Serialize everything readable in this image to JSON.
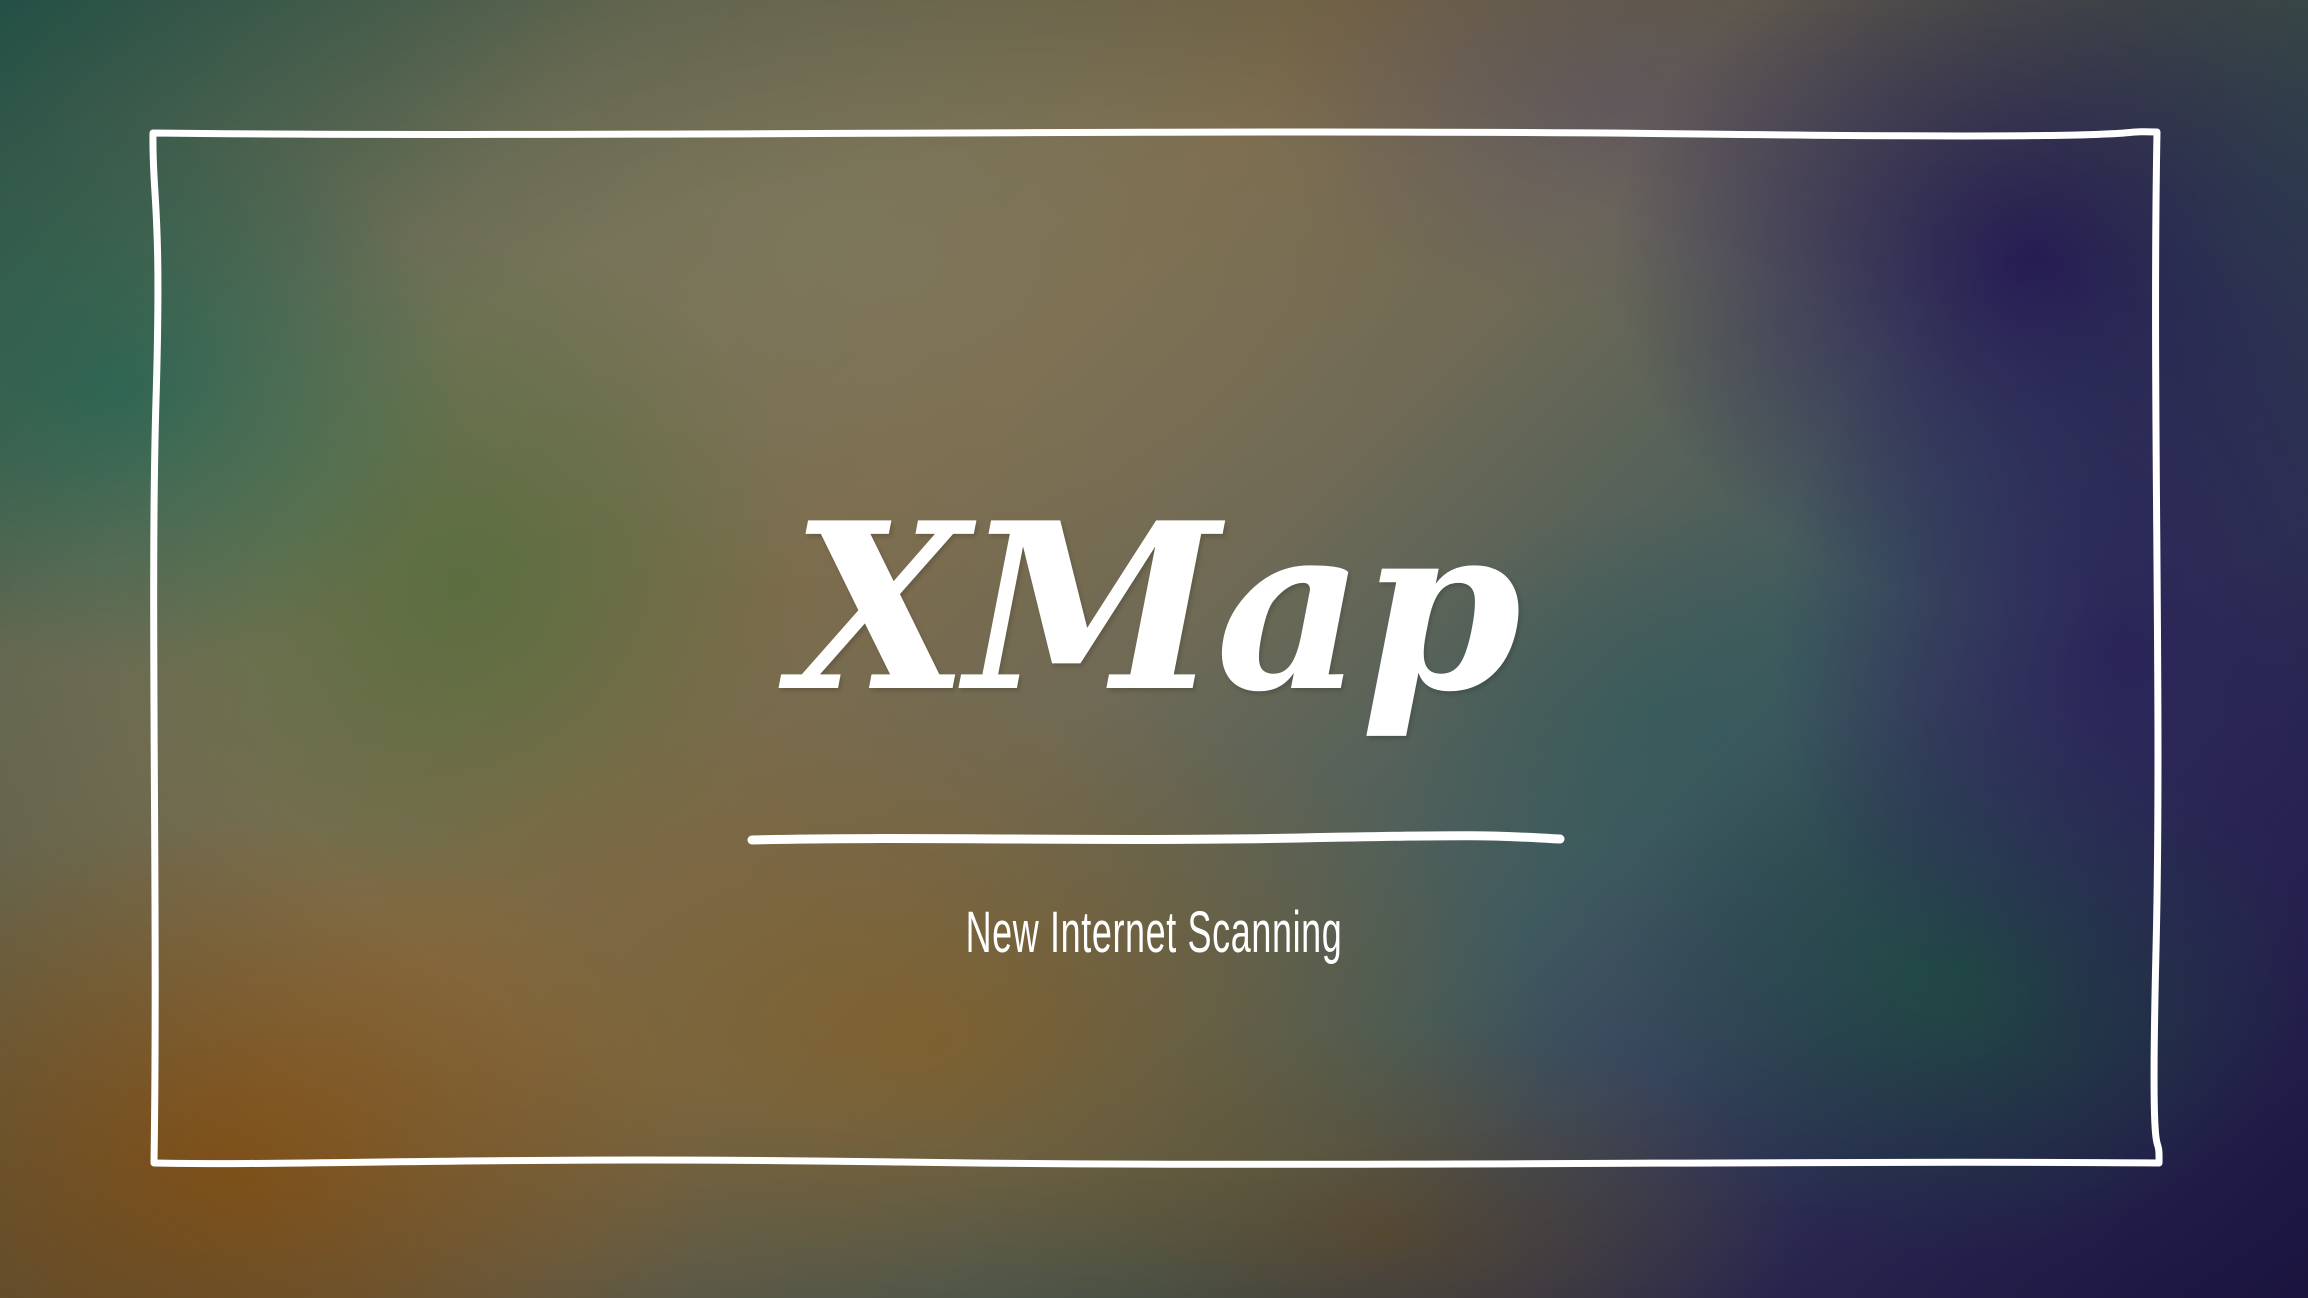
{
  "slide": {
    "title": "XMap",
    "subtitle": "New Internet Scanning"
  },
  "colors": {
    "text": "#ffffff",
    "frame": "#ffffff",
    "background_left": "#7d6c4c",
    "background_right": "#221a54"
  }
}
